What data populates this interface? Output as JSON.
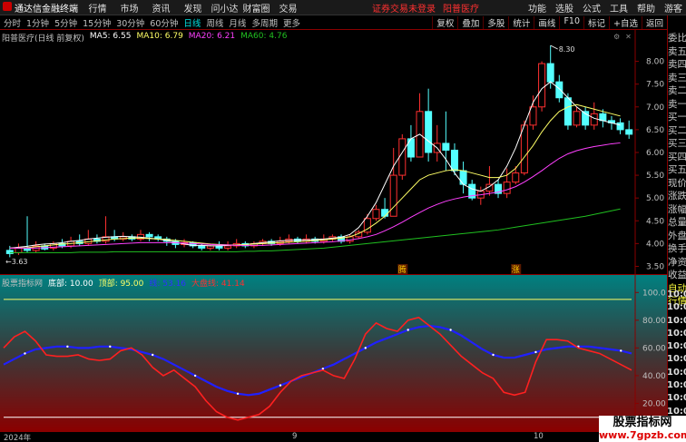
{
  "menubar": {
    "app_title": "通达信金融终端",
    "menu": [
      "行情",
      "市场",
      "资讯",
      "发现",
      "问小达",
      "财富圈",
      "交易"
    ],
    "alerts": [
      "证券交易未登录",
      "阳普医疗"
    ],
    "right": [
      "功能",
      "选股",
      "公式",
      "工具",
      "帮助",
      "游客"
    ]
  },
  "toolbar": {
    "periods": [
      "分时",
      "1分钟",
      "5分钟",
      "15分钟",
      "30分钟",
      "60分钟",
      "日线",
      "周线",
      "月线",
      "多周期",
      "更多"
    ],
    "active_period": "日线",
    "tools": [
      "复权",
      "叠加",
      "多股",
      "统计",
      "画线",
      "F10",
      "标记",
      "+自选",
      "返回"
    ]
  },
  "kline_header": {
    "title": "阳普医疗(日线 前复权)",
    "ma5": "MA5: 6.55",
    "ma10": "MA10: 6.79",
    "ma20": "MA20: 6.21",
    "ma60": "MA60: 4.76"
  },
  "price_axis": [
    "8.00",
    "7.50",
    "7.00",
    "6.50",
    "6.00",
    "5.50",
    "5.00",
    "4.50",
    "4.00",
    "3.50"
  ],
  "annotations": {
    "high": "8.30",
    "low": "3.63",
    "mark1": "腾",
    "mark2": "涨"
  },
  "indicator_header": {
    "title": "股票指标网",
    "bottom": "底部: 10.00",
    "top": "顶部: 95.00",
    "ind": "线: 53.16",
    "ind2": "大盘线: 41.14"
  },
  "ind_axis": [
    "100.0",
    "80.00",
    "60.00",
    "40.00",
    "20.00"
  ],
  "dates": [
    "2024年",
    "9",
    "10"
  ],
  "sidepanel": [
    "委比",
    "卖五",
    "卖四",
    "卖三",
    "卖二",
    "卖一",
    "买一",
    "买二",
    "买三",
    "买四",
    "买五",
    "现价",
    "涨跌",
    "涨幅",
    "总量",
    "外盘",
    "换手",
    "净资",
    "收益",
    "自动",
    "行情"
  ],
  "quote_times": [
    "10:00",
    "10:00",
    "10:00",
    "10:00",
    "10:00",
    "10:00",
    "10:00",
    "10:00",
    "10:00",
    "10:00"
  ],
  "watermark": {
    "line1": "股票指标网",
    "line2": "www.7gpzb.com"
  },
  "chart_data": [
    {
      "type": "candlestick",
      "title": "阳普医疗(日线 前复权)",
      "ylim": [
        3.35,
        8.45
      ],
      "candles": [
        {
          "o": 3.85,
          "c": 3.78,
          "h": 3.95,
          "l": 3.7
        },
        {
          "o": 3.8,
          "c": 3.9,
          "h": 4.0,
          "l": 3.75
        },
        {
          "o": 3.9,
          "c": 3.85,
          "h": 4.6,
          "l": 3.8
        },
        {
          "o": 3.85,
          "c": 3.95,
          "h": 4.05,
          "l": 3.8
        },
        {
          "o": 3.95,
          "c": 3.88,
          "h": 4.0,
          "l": 3.85
        },
        {
          "o": 3.9,
          "c": 4.0,
          "h": 4.05,
          "l": 3.85
        },
        {
          "o": 4.0,
          "c": 3.95,
          "h": 4.1,
          "l": 3.9
        },
        {
          "o": 3.95,
          "c": 4.05,
          "h": 4.15,
          "l": 3.9
        },
        {
          "o": 4.05,
          "c": 4.0,
          "h": 4.2,
          "l": 3.95
        },
        {
          "o": 4.0,
          "c": 4.1,
          "h": 4.3,
          "l": 3.95
        },
        {
          "o": 4.1,
          "c": 4.05,
          "h": 4.2,
          "l": 4.0
        },
        {
          "o": 4.05,
          "c": 4.15,
          "h": 4.6,
          "l": 4.0
        },
        {
          "o": 4.15,
          "c": 4.1,
          "h": 4.3,
          "l": 4.05
        },
        {
          "o": 4.1,
          "c": 4.15,
          "h": 4.25,
          "l": 4.05
        },
        {
          "o": 4.15,
          "c": 4.1,
          "h": 4.2,
          "l": 4.05
        },
        {
          "o": 4.1,
          "c": 4.2,
          "h": 4.3,
          "l": 4.05
        },
        {
          "o": 4.2,
          "c": 4.15,
          "h": 4.25,
          "l": 4.05
        },
        {
          "o": 4.15,
          "c": 4.1,
          "h": 4.2,
          "l": 4.05
        },
        {
          "o": 4.1,
          "c": 4.05,
          "h": 4.15,
          "l": 3.95
        },
        {
          "o": 4.05,
          "c": 3.98,
          "h": 4.1,
          "l": 3.9
        },
        {
          "o": 3.98,
          "c": 4.02,
          "h": 4.1,
          "l": 3.92
        },
        {
          "o": 4.02,
          "c": 3.95,
          "h": 4.05,
          "l": 3.9
        },
        {
          "o": 3.95,
          "c": 3.9,
          "h": 4.0,
          "l": 3.85
        },
        {
          "o": 3.9,
          "c": 3.95,
          "h": 4.0,
          "l": 3.85
        },
        {
          "o": 3.95,
          "c": 3.9,
          "h": 4.05,
          "l": 3.85
        },
        {
          "o": 3.9,
          "c": 3.95,
          "h": 4.05,
          "l": 3.85
        },
        {
          "o": 3.95,
          "c": 4.0,
          "h": 4.1,
          "l": 3.9
        },
        {
          "o": 4.0,
          "c": 3.95,
          "h": 4.05,
          "l": 3.9
        },
        {
          "o": 3.95,
          "c": 4.0,
          "h": 4.05,
          "l": 3.9
        },
        {
          "o": 4.0,
          "c": 4.05,
          "h": 4.1,
          "l": 3.95
        },
        {
          "o": 4.05,
          "c": 4.0,
          "h": 4.1,
          "l": 3.95
        },
        {
          "o": 4.0,
          "c": 4.05,
          "h": 4.15,
          "l": 3.95
        },
        {
          "o": 4.05,
          "c": 4.1,
          "h": 4.2,
          "l": 4.0
        },
        {
          "o": 4.1,
          "c": 4.05,
          "h": 4.15,
          "l": 4.0
        },
        {
          "o": 4.05,
          "c": 4.1,
          "h": 4.2,
          "l": 4.0
        },
        {
          "o": 4.1,
          "c": 4.05,
          "h": 4.15,
          "l": 4.0
        },
        {
          "o": 4.05,
          "c": 4.1,
          "h": 4.2,
          "l": 4.0
        },
        {
          "o": 4.1,
          "c": 4.15,
          "h": 4.2,
          "l": 4.05
        },
        {
          "o": 4.15,
          "c": 4.05,
          "h": 4.2,
          "l": 4.0
        },
        {
          "o": 4.05,
          "c": 4.15,
          "h": 4.2,
          "l": 4.0
        },
        {
          "o": 4.15,
          "c": 4.25,
          "h": 4.3,
          "l": 4.1
        },
        {
          "o": 4.25,
          "c": 4.55,
          "h": 4.65,
          "l": 4.2
        },
        {
          "o": 4.55,
          "c": 4.75,
          "h": 4.85,
          "l": 4.5
        },
        {
          "o": 4.75,
          "c": 4.6,
          "h": 5.0,
          "l": 4.55
        },
        {
          "o": 4.6,
          "c": 5.5,
          "h": 6.1,
          "l": 4.6
        },
        {
          "o": 5.5,
          "c": 6.3,
          "h": 6.4,
          "l": 5.4
        },
        {
          "o": 6.3,
          "c": 5.9,
          "h": 6.6,
          "l": 5.8
        },
        {
          "o": 5.9,
          "c": 6.9,
          "h": 7.3,
          "l": 5.9
        },
        {
          "o": 6.9,
          "c": 6.0,
          "h": 7.4,
          "l": 5.8
        },
        {
          "o": 6.0,
          "c": 6.2,
          "h": 6.6,
          "l": 5.8
        },
        {
          "o": 6.2,
          "c": 6.05,
          "h": 6.9,
          "l": 5.6
        },
        {
          "o": 6.05,
          "c": 5.6,
          "h": 6.2,
          "l": 5.5
        },
        {
          "o": 5.6,
          "c": 5.3,
          "h": 5.8,
          "l": 5.1
        },
        {
          "o": 5.3,
          "c": 5.0,
          "h": 5.4,
          "l": 4.95
        },
        {
          "o": 5.0,
          "c": 5.15,
          "h": 5.25,
          "l": 4.85
        },
        {
          "o": 5.15,
          "c": 5.3,
          "h": 5.7,
          "l": 5.05
        },
        {
          "o": 5.3,
          "c": 5.1,
          "h": 5.4,
          "l": 5.0
        },
        {
          "o": 5.1,
          "c": 5.35,
          "h": 5.65,
          "l": 5.0
        },
        {
          "o": 5.35,
          "c": 5.55,
          "h": 5.7,
          "l": 5.3
        },
        {
          "o": 5.55,
          "c": 6.6,
          "h": 6.7,
          "l": 5.5
        },
        {
          "o": 6.6,
          "c": 7.0,
          "h": 7.25,
          "l": 6.5
        },
        {
          "o": 7.0,
          "c": 7.95,
          "h": 8.0,
          "l": 6.9
        },
        {
          "o": 7.95,
          "c": 7.55,
          "h": 8.35,
          "l": 7.4
        },
        {
          "o": 7.55,
          "c": 7.2,
          "h": 7.7,
          "l": 7.1
        },
        {
          "o": 7.2,
          "c": 6.6,
          "h": 7.3,
          "l": 6.5
        },
        {
          "o": 6.6,
          "c": 6.9,
          "h": 7.0,
          "l": 6.55
        },
        {
          "o": 6.9,
          "c": 6.6,
          "h": 7.0,
          "l": 6.5
        },
        {
          "o": 6.6,
          "c": 6.85,
          "h": 7.1,
          "l": 6.5
        },
        {
          "o": 6.85,
          "c": 6.7,
          "h": 6.95,
          "l": 6.55
        },
        {
          "o": 6.7,
          "c": 6.65,
          "h": 6.8,
          "l": 6.5
        },
        {
          "o": 6.65,
          "c": 6.5,
          "h": 6.75,
          "l": 6.4
        },
        {
          "o": 6.5,
          "c": 6.4,
          "h": 6.7,
          "l": 6.3
        }
      ],
      "series": [
        {
          "name": "MA5",
          "color": "#ffffff",
          "values": [
            3.9,
            3.92,
            3.94,
            3.97,
            3.99,
            4.0,
            4.02,
            4.05,
            4.07,
            4.1,
            4.12,
            4.14,
            4.15,
            4.16,
            4.15,
            4.14,
            4.12,
            4.1,
            4.07,
            4.03,
            3.99,
            3.96,
            3.96,
            3.95,
            3.95,
            3.96,
            3.97,
            3.98,
            4.0,
            4.02,
            4.04,
            4.06,
            4.07,
            4.08,
            4.08,
            4.09,
            4.1,
            4.12,
            4.14,
            4.2,
            4.35,
            4.6,
            4.9,
            5.3,
            5.7,
            6.0,
            6.3,
            6.4,
            6.25,
            6.1,
            5.85,
            5.55,
            5.3,
            5.2,
            5.15,
            5.25,
            5.4,
            5.7,
            6.1,
            6.6,
            7.1,
            7.4,
            7.55,
            7.4,
            7.2,
            7.0,
            6.85,
            6.75,
            6.7,
            6.65,
            6.6
          ]
        },
        {
          "name": "MA10",
          "color": "#ffff66",
          "values": [
            3.9,
            3.9,
            3.91,
            3.93,
            3.95,
            3.97,
            3.99,
            4.0,
            4.02,
            4.04,
            4.06,
            4.08,
            4.1,
            4.11,
            4.12,
            4.12,
            4.11,
            4.1,
            4.09,
            4.07,
            4.05,
            4.03,
            4.01,
            3.99,
            3.98,
            3.97,
            3.97,
            3.98,
            3.99,
            4.0,
            4.01,
            4.02,
            4.03,
            4.04,
            4.05,
            4.07,
            4.08,
            4.1,
            4.12,
            4.15,
            4.22,
            4.32,
            4.45,
            4.6,
            4.8,
            5.0,
            5.2,
            5.4,
            5.5,
            5.55,
            5.6,
            5.62,
            5.6,
            5.55,
            5.5,
            5.45,
            5.45,
            5.5,
            5.65,
            5.9,
            6.15,
            6.45,
            6.7,
            6.9,
            7.0,
            7.05,
            7.0,
            6.95,
            6.9,
            6.85,
            6.8
          ]
        },
        {
          "name": "MA20",
          "color": "#ff40ff",
          "values": [
            3.9,
            3.9,
            3.9,
            3.9,
            3.91,
            3.92,
            3.93,
            3.94,
            3.95,
            3.96,
            3.97,
            3.98,
            3.99,
            4.0,
            4.01,
            4.02,
            4.02,
            4.02,
            4.02,
            4.02,
            4.01,
            4.0,
            3.99,
            3.98,
            3.97,
            3.97,
            3.96,
            3.96,
            3.96,
            3.96,
            3.97,
            3.98,
            3.99,
            4.0,
            4.01,
            4.02,
            4.03,
            4.04,
            4.06,
            4.08,
            4.11,
            4.15,
            4.2,
            4.28,
            4.37,
            4.47,
            4.58,
            4.68,
            4.78,
            4.86,
            4.93,
            4.98,
            5.02,
            5.05,
            5.07,
            5.1,
            5.13,
            5.18,
            5.25,
            5.35,
            5.47,
            5.6,
            5.74,
            5.87,
            5.97,
            6.04,
            6.09,
            6.13,
            6.16,
            6.19,
            6.21
          ]
        },
        {
          "name": "MA60",
          "color": "#20c020",
          "values": [
            3.8,
            3.8,
            3.8,
            3.8,
            3.8,
            3.8,
            3.8,
            3.8,
            3.81,
            3.81,
            3.81,
            3.81,
            3.82,
            3.82,
            3.82,
            3.82,
            3.82,
            3.82,
            3.82,
            3.82,
            3.82,
            3.82,
            3.82,
            3.82,
            3.82,
            3.82,
            3.82,
            3.83,
            3.83,
            3.84,
            3.84,
            3.85,
            3.86,
            3.87,
            3.88,
            3.89,
            3.9,
            3.92,
            3.94,
            3.96,
            3.98,
            4.0,
            4.02,
            4.04,
            4.06,
            4.08,
            4.1,
            4.12,
            4.14,
            4.16,
            4.18,
            4.2,
            4.22,
            4.24,
            4.26,
            4.28,
            4.3,
            4.33,
            4.36,
            4.39,
            4.42,
            4.45,
            4.48,
            4.51,
            4.54,
            4.57,
            4.6,
            4.64,
            4.68,
            4.72,
            4.76
          ]
        }
      ]
    },
    {
      "type": "line",
      "title": "股票指标网",
      "ylim": [
        0,
        110
      ],
      "reference_lines": [
        {
          "value": 95,
          "color": "#ffff66"
        },
        {
          "value": 10,
          "color": "#ffffff"
        }
      ],
      "series": [
        {
          "name": "线",
          "color": "#2020ff",
          "values": [
            48,
            52,
            56,
            59,
            60,
            61,
            61,
            60,
            60,
            61,
            61,
            60,
            59,
            57,
            55,
            52,
            48,
            44,
            40,
            36,
            32,
            29,
            27,
            26,
            27,
            30,
            33,
            36,
            39,
            42,
            45,
            48,
            52,
            56,
            60,
            64,
            67,
            70,
            73,
            75,
            76,
            75,
            73,
            69,
            64,
            59,
            55,
            53,
            53,
            55,
            57,
            59,
            60,
            61,
            61,
            61,
            60,
            59,
            58,
            56
          ]
        },
        {
          "name": "大盘线",
          "color": "#ff2020",
          "values": [
            60,
            68,
            72,
            65,
            55,
            54,
            54,
            55,
            52,
            51,
            52,
            58,
            60,
            55,
            46,
            40,
            44,
            38,
            32,
            22,
            14,
            10,
            8,
            10,
            12,
            18,
            28,
            36,
            40,
            42,
            44,
            40,
            38,
            52,
            70,
            78,
            74,
            72,
            80,
            82,
            76,
            70,
            62,
            54,
            48,
            42,
            38,
            28,
            26,
            28,
            50,
            66,
            66,
            65,
            60,
            58,
            56,
            52,
            48,
            44
          ]
        }
      ]
    }
  ]
}
